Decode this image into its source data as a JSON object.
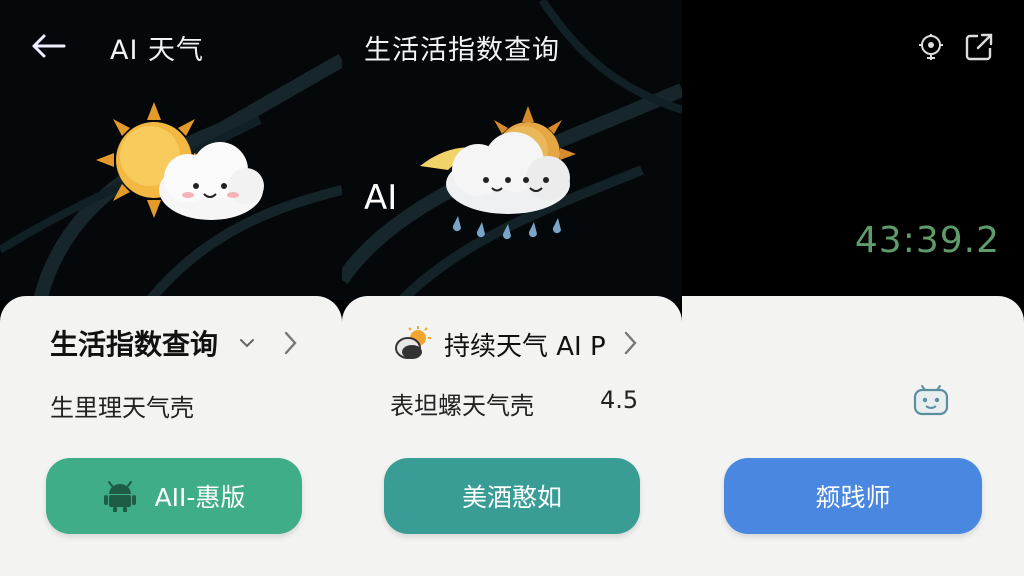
{
  "panels": [
    {
      "header": {
        "title": "AI 天气"
      },
      "card": {
        "title": "生活指数查询",
        "subtitle": "生里理天气壳",
        "button_label": "AII-惠版"
      }
    },
    {
      "header": {
        "title": "生活活指数查询",
        "overlay_label": "AI"
      },
      "card": {
        "title": "持续天气 AI P",
        "subtitle": "表坦螺天气壳",
        "value": "4.5",
        "button_label": "美酒憨如"
      }
    },
    {
      "header": {
        "time": "43:39.2"
      },
      "card": {
        "button_label": "颒践师"
      }
    }
  ],
  "icons": {
    "back": "arrow-left-icon",
    "settings": "location-gear-icon",
    "external": "open-external-icon",
    "android": "android-robot-icon",
    "bot": "robot-face-icon",
    "sun_cloud": "sun-cloud-icon",
    "rain_cloud": "rain-cloud-icon",
    "partly_sunny": "partly-sunny-icon"
  },
  "colors": {
    "green_button": "#3fae88",
    "teal_button": "#3a9d95",
    "blue_button": "#4a87e0",
    "time_text": "#5f9c6c",
    "card_bg": "#f3f4f2"
  }
}
